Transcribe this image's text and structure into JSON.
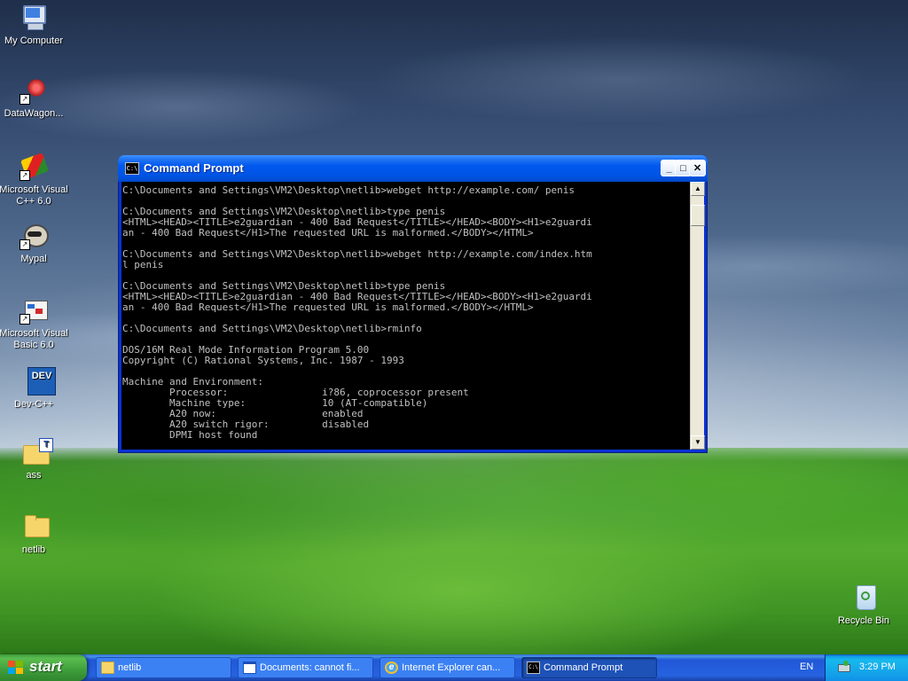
{
  "desktop": {
    "icons": [
      {
        "label": "My Computer"
      },
      {
        "label": "DataWagon..."
      },
      {
        "label": "Microsoft Visual C++ 6.0"
      },
      {
        "label": "Mypal"
      },
      {
        "label": "Microsoft Visual Basic 6.0"
      },
      {
        "label": "Dev-C++"
      },
      {
        "label": "ass"
      },
      {
        "label": "netlib"
      },
      {
        "label": "Recycle Bin"
      }
    ]
  },
  "window": {
    "title": "Command Prompt",
    "icon_text": "C:\\",
    "controls": {
      "minimize": "_",
      "maximize": "□",
      "close": "✕"
    },
    "console_lines": [
      "C:\\Documents and Settings\\VM2\\Desktop\\netlib>webget http://example.com/ penis",
      "",
      "C:\\Documents and Settings\\VM2\\Desktop\\netlib>type penis",
      "<HTML><HEAD><TITLE>e2guardian - 400 Bad Request</TITLE></HEAD><BODY><H1>e2guardi",
      "an - 400 Bad Request</H1>The requested URL is malformed.</BODY></HTML>",
      "",
      "C:\\Documents and Settings\\VM2\\Desktop\\netlib>webget http://example.com/index.htm",
      "l penis",
      "",
      "C:\\Documents and Settings\\VM2\\Desktop\\netlib>type penis",
      "<HTML><HEAD><TITLE>e2guardian - 400 Bad Request</TITLE></HEAD><BODY><H1>e2guardi",
      "an - 400 Bad Request</H1>The requested URL is malformed.</BODY></HTML>",
      "",
      "C:\\Documents and Settings\\VM2\\Desktop\\netlib>rminfo",
      "",
      "DOS/16M Real Mode Information Program 5.00",
      "Copyright (C) Rational Systems, Inc. 1987 - 1993",
      "",
      "Machine and Environment:",
      "        Processor:                i?86, coprocessor present",
      "        Machine type:             10 (AT-compatible)",
      "        A20 now:                  enabled",
      "        A20 switch rigor:         disabled",
      "        DPMI host found"
    ]
  },
  "taskbar": {
    "start_label": "start",
    "tasks": [
      {
        "label": "netlib",
        "icon": "folder-icon"
      },
      {
        "label": "Documents: cannot fi...",
        "icon": "window-icon"
      },
      {
        "label": "Internet Explorer can...",
        "icon": "internet-explorer-icon"
      },
      {
        "label": "Command Prompt",
        "icon": "command-prompt-icon",
        "active": true
      }
    ],
    "language": "EN",
    "clock": "3:29 PM"
  }
}
